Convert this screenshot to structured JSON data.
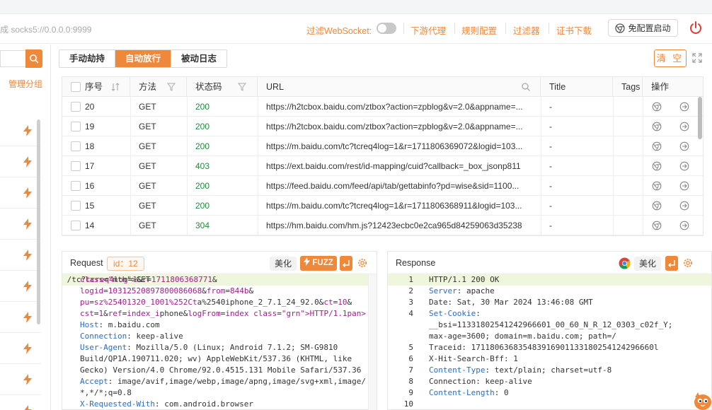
{
  "topbar": {
    "proxy_text": "成 socks5://0.0.0.0:9999",
    "ws_label": "过滤WebSocket:",
    "links": [
      "下游代理",
      "规则配置",
      "过滤器",
      "证书下载"
    ],
    "start_button": "免配置启动"
  },
  "left": {
    "manage_group": "管理分组",
    "item_count": 10
  },
  "tabs": [
    "手动劫持",
    "自动放行",
    "被动日志"
  ],
  "active_tab": "自动放行",
  "clear_button": "清 空",
  "table": {
    "headers": {
      "index": "序号",
      "method": "方法",
      "status": "状态码",
      "url": "URL",
      "title": "Title",
      "tags": "Tags",
      "actions": "操作"
    },
    "rows": [
      {
        "id": "20",
        "method": "GET",
        "status": "200",
        "url": "https://h2tcbox.baidu.com/ztbox?action=zpblog&v=2.0&appname=...",
        "title": "-"
      },
      {
        "id": "19",
        "method": "GET",
        "status": "200",
        "url": "https://h2tcbox.baidu.com/ztbox?action=zpblog&v=2.0&appname=...",
        "title": "-"
      },
      {
        "id": "18",
        "method": "GET",
        "status": "200",
        "url": "https://m.baidu.com/tc?tcreq4log=1&r=1711806369072&logid=103...",
        "title": "-"
      },
      {
        "id": "17",
        "method": "GET",
        "status": "403",
        "url": "https://ext.baidu.com/rest/id-mapping/cuid?callback=_box_jsonp811",
        "title": "-"
      },
      {
        "id": "16",
        "method": "GET",
        "status": "200",
        "url": "https://feed.baidu.com/feed/api/tab/gettabinfo?pd=wise&sid=1100...",
        "title": "-"
      },
      {
        "id": "15",
        "method": "GET",
        "status": "200",
        "url": "https://m.baidu.com/tc?tcreq4log=1&r=1711806368911&logid=103...",
        "title": "-"
      },
      {
        "id": "14",
        "method": "GET",
        "status": "304",
        "url": "https://hm.baidu.com/hm.js?12423ecbc0e2ca965d84259063d35238",
        "title": "-"
      }
    ]
  },
  "request": {
    "title": "Request",
    "id_label": "id：12",
    "beautify": "美化",
    "fuzz": "FUZZ",
    "lines": [
      "GET /tc?tcreq4log=1&r=1711806368771&",
      "logid=10312520897800086068&from=844b&",
      "pu=sz%25401320_1001%252Cta%2540iphone_2_7.1_24_92.0&ct=10&",
      "cst=1&ref=index_iphone&logFrom=index HTTP/1.1",
      "Host: m.baidu.com",
      "Connection: keep-alive",
      "User-Agent: Mozilla/5.0 (Linux; Android 7.1.2; SM-G9810",
      "Build/QP1A.190711.020; wv) AppleWebKit/537.36 (KHTML, like",
      "Gecko) Version/4.0 Chrome/92.0.4515.131 Mobile Safari/537.36",
      "Accept: image/avif,image/webp,image/apng,image/svg+xml,image/",
      "*,*/*;q=0.8",
      "X-Requested-With: com.android.browser"
    ]
  },
  "response": {
    "title": "Response",
    "beautify": "美化",
    "lines": [
      {
        "n": "1",
        "t": "HTTP/1.1 200 OK"
      },
      {
        "n": "2",
        "t": "Server: apache"
      },
      {
        "n": "3",
        "t": "Date: Sat, 30 Mar 2024 13:46:08 GMT"
      },
      {
        "n": "4",
        "t": "Set-Cookie:"
      },
      {
        "n": "",
        "t": "__bsi=11331802541242966601_00_60_N_R_12_0303_c02f_Y;"
      },
      {
        "n": "",
        "t": "max-age=3600; domain=m.baidu.com; path=/"
      },
      {
        "n": "5",
        "t": "Traceid: 171180636835483916901133180254124296660l"
      },
      {
        "n": "6",
        "t": "X-Hit-Search-Bff: 1"
      },
      {
        "n": "7",
        "t": "Content-Type: text/plain; charset=utf-8"
      },
      {
        "n": "8",
        "t": "Connection: keep-alive"
      },
      {
        "n": "9",
        "t": "Content-Length: 0"
      },
      {
        "n": "10",
        "t": ""
      }
    ]
  },
  "colors": {
    "accent": "#f0883a",
    "status_green": "#1f8a3b"
  }
}
